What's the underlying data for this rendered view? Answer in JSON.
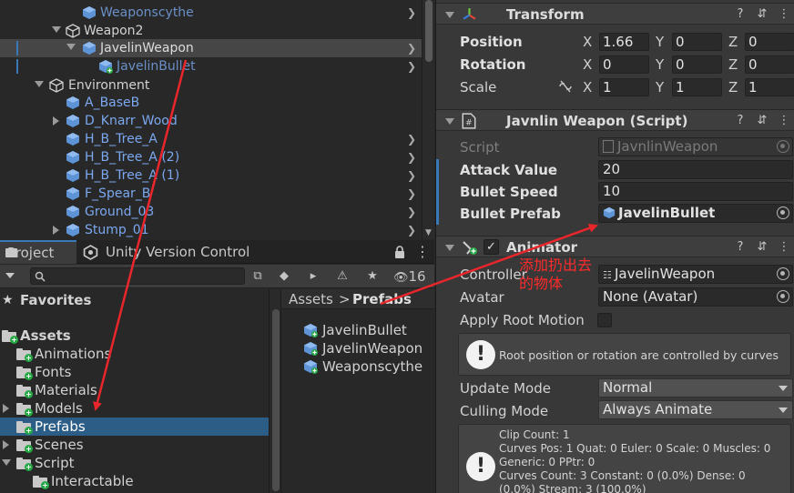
{
  "hierarchy": {
    "rows": [
      {
        "label": "Weaponscythe"
      },
      {
        "label": "Weapon2"
      },
      {
        "label": "JavelinWeapon"
      },
      {
        "label": "JavelinBullet"
      },
      {
        "label": "Environment"
      },
      {
        "label": "A_BaseB"
      },
      {
        "label": "D_Knarr_Wood"
      },
      {
        "label": "H_B_Tree_A"
      },
      {
        "label": "H_B_Tree_A (2)"
      },
      {
        "label": "H_B_Tree_A (1)"
      },
      {
        "label": "F_Spear_B"
      },
      {
        "label": "Ground_03"
      },
      {
        "label": "Stump_01"
      }
    ]
  },
  "project": {
    "tabs": [
      {
        "label": "Project"
      },
      {
        "label": "Unity Version Control"
      }
    ],
    "search": {
      "value": "",
      "placeholder": ""
    },
    "hidden_count": "16",
    "favorites_label": "Favorites",
    "assets_label": "Assets",
    "folders": [
      {
        "label": "Animations"
      },
      {
        "label": "Fonts"
      },
      {
        "label": "Materials"
      },
      {
        "label": "Models"
      },
      {
        "label": "Prefabs"
      },
      {
        "label": "Scenes"
      },
      {
        "label": "Script"
      },
      {
        "label": "Interactable"
      }
    ],
    "breadcrumb": {
      "root": "Assets",
      "separator": ">",
      "current": "Prefabs"
    },
    "prefabs": [
      {
        "label": "JavelinBullet"
      },
      {
        "label": "JavelinWeapon"
      },
      {
        "label": "Weaponscythe"
      }
    ]
  },
  "inspector": {
    "transform": {
      "title": "Transform",
      "position": {
        "label": "Position",
        "x": "1.66",
        "y": "0",
        "z": "0"
      },
      "rotation": {
        "label": "Rotation",
        "x": "0",
        "y": "0",
        "z": "0"
      },
      "scale": {
        "label": "Scale",
        "x": "1",
        "y": "1",
        "z": "1"
      },
      "axis_x": "X",
      "axis_y": "Y",
      "axis_z": "Z"
    },
    "script_component": {
      "title": "Javnlin Weapon (Script)",
      "script_label": "Script",
      "script_value": "JavnlinWeapon",
      "attack_label": "Attack Value",
      "attack_value": "20",
      "speed_label": "Bullet Speed",
      "speed_value": "10",
      "prefab_label": "Bullet Prefab",
      "prefab_value": "JavelinBullet"
    },
    "animator": {
      "title": "Animator",
      "controller_label": "Controller",
      "controller_value": "JavelinWeapon",
      "avatar_label": "Avatar",
      "avatar_value": "None (Avatar)",
      "root_motion_label": "Apply Root Motion",
      "help_1": "Root position or rotation are controlled by curves",
      "update_label": "Update Mode",
      "update_value": "Normal",
      "culling_label": "Culling Mode",
      "culling_value": "Always Animate",
      "stats": "Clip Count: 1\nCurves Pos: 1 Quat: 0 Euler: 0 Scale: 0 Muscles: 0\nGeneric: 0 PPtr: 0\nCurves Count: 3 Constant: 0 (0.0%) Dense: 0\n(0.0%) Stream: 3 (100.0%)"
    }
  },
  "annotation": {
    "line1": "添加扔出去",
    "line2": "的物体",
    "color": "#ff2a2a"
  },
  "colors": {
    "selection": "#2c5d87",
    "accent": "#3a79b8",
    "prefab_text": "#7ba8f0"
  }
}
